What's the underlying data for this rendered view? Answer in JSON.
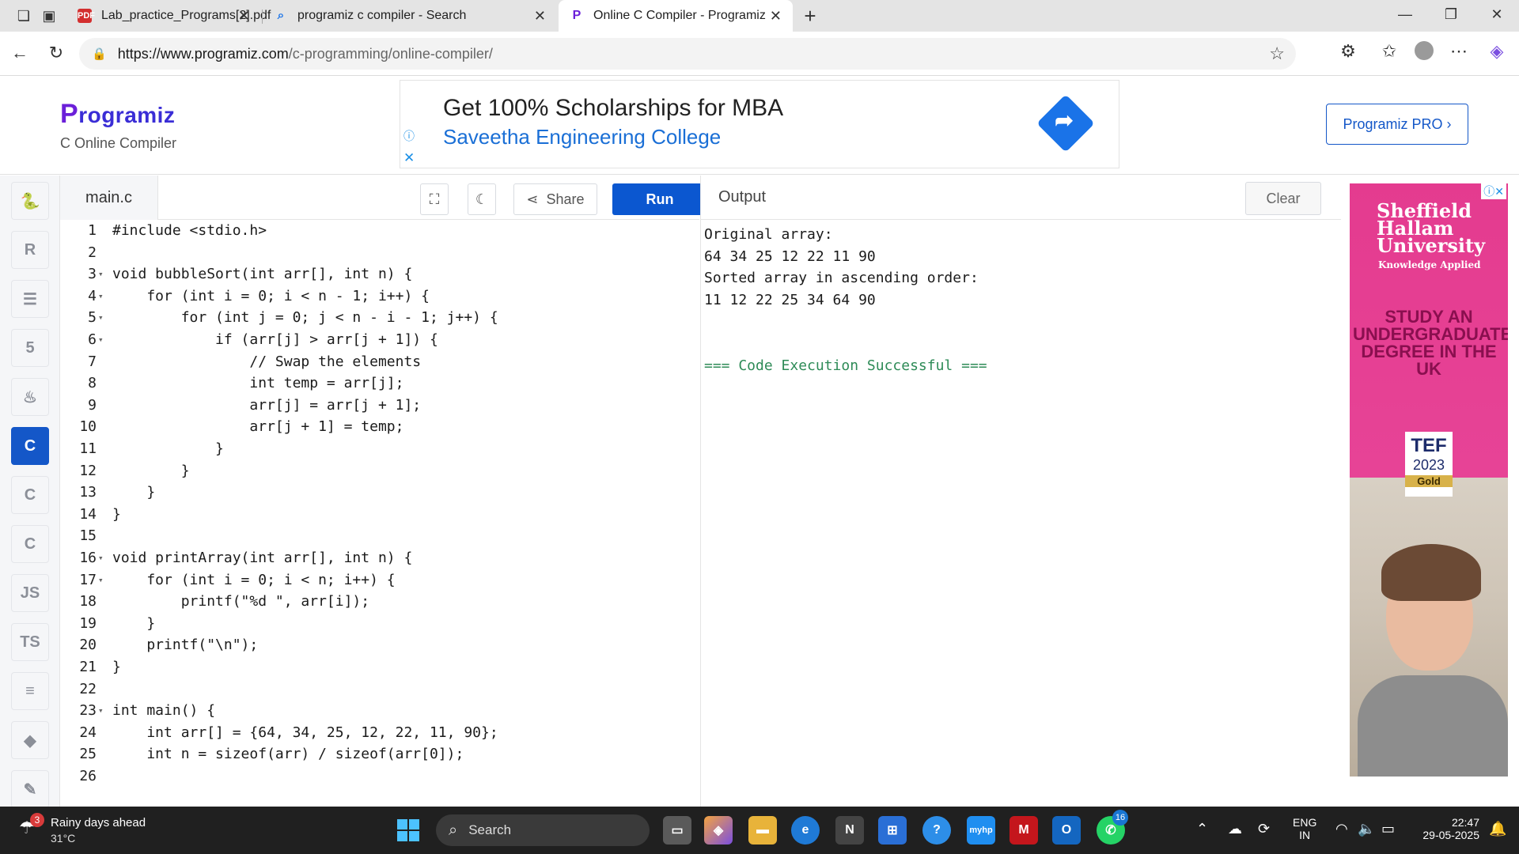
{
  "browser": {
    "tabs": [
      {
        "title": "Lab_practice_Programs[2].pdf",
        "favicon": "pdf-icon"
      },
      {
        "title": "programiz c compiler - Search",
        "favicon": "search-icon"
      },
      {
        "title": "Online C Compiler - Programiz",
        "favicon": "programiz-icon"
      }
    ],
    "url_host": "https://www.programiz.com",
    "url_path": "/c-programming/online-compiler/"
  },
  "header": {
    "logo_mark": "P",
    "logo_text": "rogramiz",
    "subtitle": "C Online Compiler",
    "pro_button": "Programiz PRO ›"
  },
  "banner_ad": {
    "headline": "Get 100% Scholarships for MBA",
    "advertiser": "Saveetha Engineering College"
  },
  "rail": {
    "items": [
      {
        "name": "python-icon",
        "glyph": "🐍",
        "active": false
      },
      {
        "name": "r-icon",
        "glyph": "R",
        "active": false
      },
      {
        "name": "sql-icon",
        "glyph": "☰",
        "active": false
      },
      {
        "name": "html-icon",
        "glyph": "5",
        "active": false
      },
      {
        "name": "java-icon",
        "glyph": "♨",
        "active": false
      },
      {
        "name": "c-icon",
        "glyph": "C",
        "active": true
      },
      {
        "name": "cpp-icon",
        "glyph": "C",
        "active": false
      },
      {
        "name": "csharp-icon",
        "glyph": "C",
        "active": false
      },
      {
        "name": "js-icon",
        "glyph": "JS",
        "active": false
      },
      {
        "name": "ts-icon",
        "glyph": "TS",
        "active": false
      },
      {
        "name": "go-icon",
        "glyph": "≡",
        "active": false
      },
      {
        "name": "swift-icon",
        "glyph": "◆",
        "active": false
      },
      {
        "name": "kotlin-icon",
        "glyph": "✎",
        "active": false
      }
    ]
  },
  "editor": {
    "filename": "main.c",
    "share_label": "Share",
    "run_label": "Run",
    "lines": [
      {
        "n": "1",
        "fold": "",
        "code": "#include <stdio.h>"
      },
      {
        "n": "2",
        "fold": "",
        "code": ""
      },
      {
        "n": "3",
        "fold": "▾",
        "code": "void bubbleSort(int arr[], int n) {"
      },
      {
        "n": "4",
        "fold": "▾",
        "code": "    for (int i = 0; i < n - 1; i++) {"
      },
      {
        "n": "5",
        "fold": "▾",
        "code": "        for (int j = 0; j < n - i - 1; j++) {"
      },
      {
        "n": "6",
        "fold": "▾",
        "code": "            if (arr[j] > arr[j + 1]) {"
      },
      {
        "n": "7",
        "fold": "",
        "code": "                // Swap the elements"
      },
      {
        "n": "8",
        "fold": "",
        "code": "                int temp = arr[j];"
      },
      {
        "n": "9",
        "fold": "",
        "code": "                arr[j] = arr[j + 1];"
      },
      {
        "n": "10",
        "fold": "",
        "code": "                arr[j + 1] = temp;"
      },
      {
        "n": "11",
        "fold": "",
        "code": "            }"
      },
      {
        "n": "12",
        "fold": "",
        "code": "        }"
      },
      {
        "n": "13",
        "fold": "",
        "code": "    }"
      },
      {
        "n": "14",
        "fold": "",
        "code": "}"
      },
      {
        "n": "15",
        "fold": "",
        "code": ""
      },
      {
        "n": "16",
        "fold": "▾",
        "code": "void printArray(int arr[], int n) {"
      },
      {
        "n": "17",
        "fold": "▾",
        "code": "    for (int i = 0; i < n; i++) {"
      },
      {
        "n": "18",
        "fold": "",
        "code": "        printf(\"%d \", arr[i]);"
      },
      {
        "n": "19",
        "fold": "",
        "code": "    }"
      },
      {
        "n": "20",
        "fold": "",
        "code": "    printf(\"\\n\");"
      },
      {
        "n": "21",
        "fold": "",
        "code": "}"
      },
      {
        "n": "22",
        "fold": "",
        "code": ""
      },
      {
        "n": "23",
        "fold": "▾",
        "code": "int main() {"
      },
      {
        "n": "24",
        "fold": "",
        "code": "    int arr[] = {64, 34, 25, 12, 22, 11, 90};"
      },
      {
        "n": "25",
        "fold": "",
        "code": "    int n = sizeof(arr) / sizeof(arr[0]);"
      },
      {
        "n": "26",
        "fold": "",
        "code": ""
      }
    ]
  },
  "output": {
    "title": "Output",
    "clear_label": "Clear",
    "lines": [
      {
        "text": "Original array:",
        "color": "#1b1b1b"
      },
      {
        "text": "64 34 25 12 22 11 90",
        "color": "#1b1b1b"
      },
      {
        "text": "Sorted array in ascending order:",
        "color": "#1b1b1b"
      },
      {
        "text": "11 12 22 25 34 64 90",
        "color": "#1b1b1b"
      },
      {
        "text": "",
        "color": "#1b1b1b"
      },
      {
        "text": "",
        "color": "#1b1b1b"
      },
      {
        "text": "=== Code Execution Successful ===",
        "color": "#2e8b57"
      }
    ]
  },
  "side_ad": {
    "university": "Sheffield Hallam University",
    "tagline": "Knowledge Applied",
    "pitch": "STUDY AN UNDERGRADUATE DEGREE IN THE UK",
    "tef": "TEF",
    "tef_year": "2023",
    "tef_award": "Gold"
  },
  "taskbar": {
    "weather_title": "Rainy days ahead",
    "weather_temp": "31°C",
    "weather_badge": "3",
    "search_placeholder": "Search",
    "whatsapp_badge": "16",
    "lang_top": "ENG",
    "lang_bottom": "IN",
    "time": "22:47",
    "date": "29-05-2025"
  }
}
